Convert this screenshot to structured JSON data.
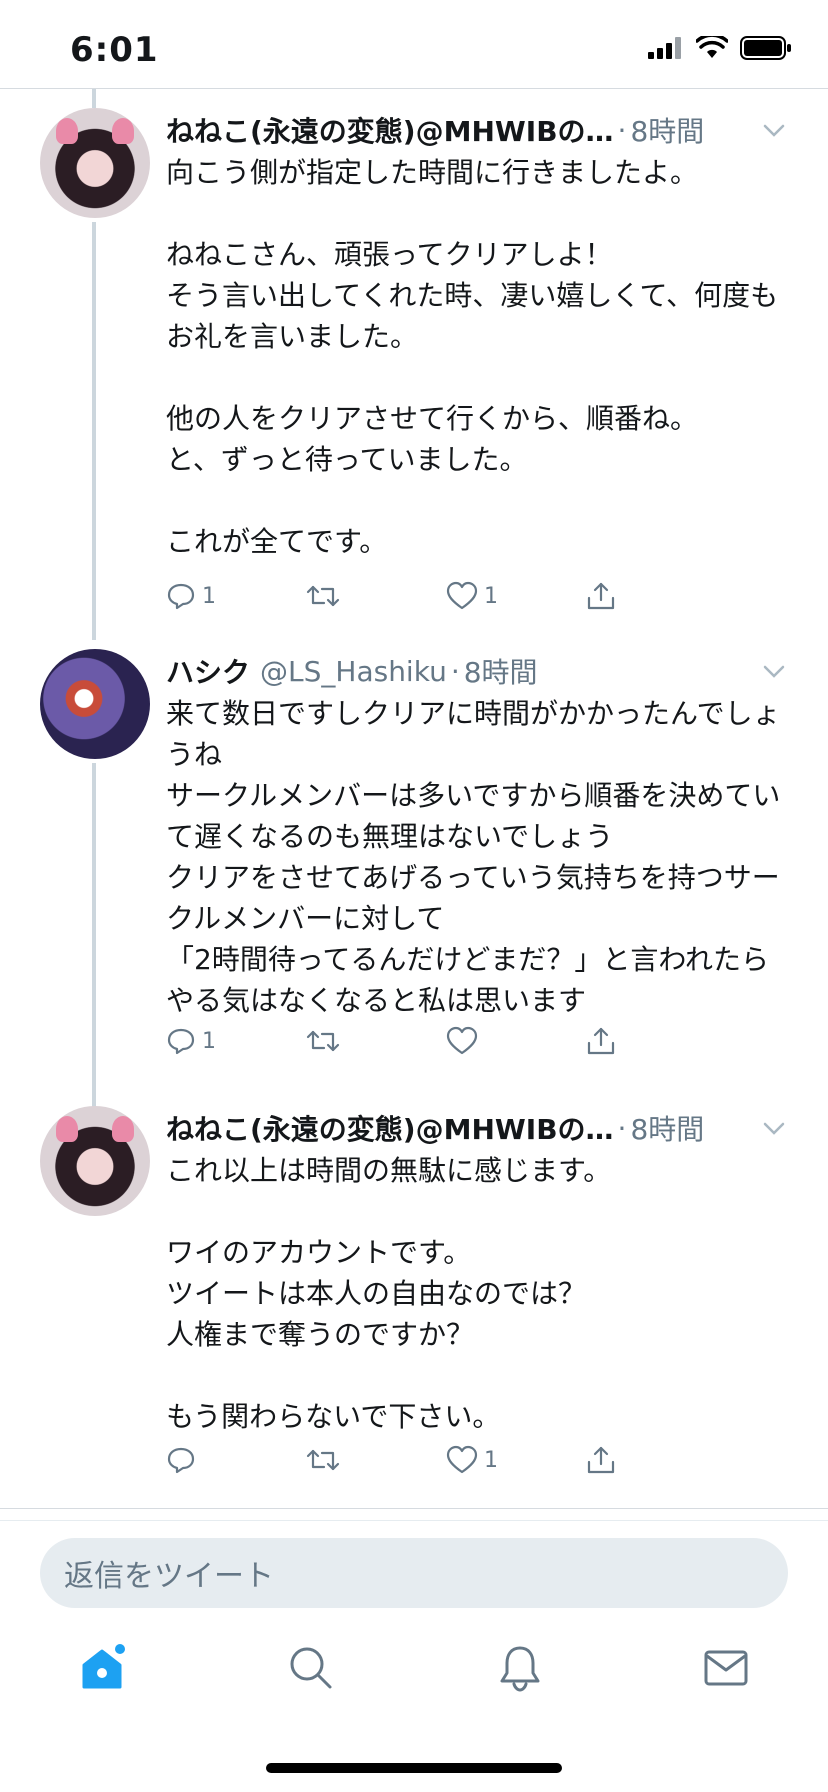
{
  "status_bar": {
    "time": "6:01"
  },
  "tweets": [
    {
      "name": "ねねこ(永遠の変態)@MHWIBの…",
      "handle": "",
      "time": "8時間",
      "text": "向こう側が指定した時間に行きましたよ。\n\nねねこさん、頑張ってクリアしよ！\nそう言い出してくれた時、凄い嬉しくて、何度もお礼を言いました。\n\n他の人をクリアさせて行くから、順番ね。\nと、ずっと待っていました。\n\nこれが全てです。",
      "reply_count": "1",
      "retweet_count": "",
      "like_count": "1"
    },
    {
      "name": "ハシク",
      "handle": "@LS_Hashiku",
      "time": "8時間",
      "text": "来て数日ですしクリアに時間がかかったんでしょうね\nサークルメンバーは多いですから順番を決めていて遅くなるのも無理はないでしょう\nクリアをさせてあげるっていう気持ちを持つサークルメンバーに対して\n「2時間待ってるんだけどまだ？」と言われたらやる気はなくなると私は思います",
      "reply_count": "1",
      "retweet_count": "",
      "like_count": ""
    },
    {
      "name": "ねねこ(永遠の変態)@MHWIBの…",
      "handle": "",
      "time": "8時間",
      "text": "これ以上は時間の無駄に感じます。\n\nワイのアカウントです。\nツイートは本人の自由なのでは？\n人権まで奪うのですか？\n\nもう関わらないで下さい。",
      "reply_count": "",
      "retweet_count": "",
      "like_count": "1"
    }
  ],
  "reply_box": {
    "placeholder": "返信をツイート"
  },
  "tabbar": {
    "items": [
      "home-icon",
      "search-icon",
      "notifications-icon",
      "messages-icon"
    ]
  },
  "colors": {
    "accent": "#1da1f2",
    "secondary_text": "#657786",
    "divider": "#d6dbe0"
  }
}
